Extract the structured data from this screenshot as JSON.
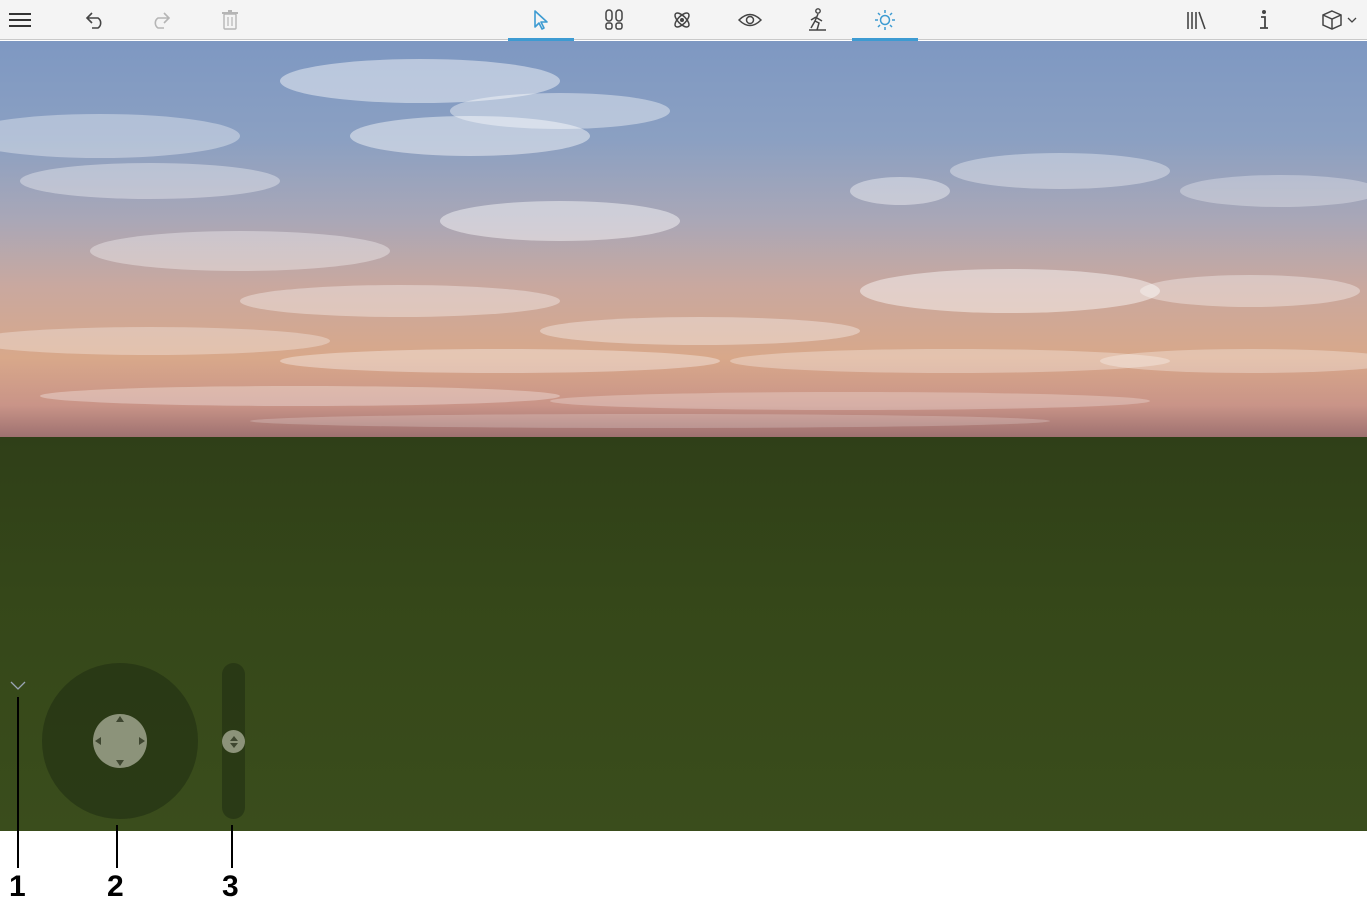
{
  "toolbar": {
    "left": [
      {
        "name": "menu-icon"
      },
      {
        "name": "undo-icon"
      },
      {
        "name": "redo-icon"
      },
      {
        "name": "delete-icon"
      }
    ],
    "modes": [
      {
        "name": "select-mode-icon",
        "active": true
      },
      {
        "name": "walk-footprints-icon",
        "active": false
      },
      {
        "name": "orbit-icon",
        "active": false
      },
      {
        "name": "view-eye-icon",
        "active": false
      },
      {
        "name": "person-walk-icon",
        "active": false
      },
      {
        "name": "sun-light-icon",
        "active": true
      }
    ],
    "right": [
      {
        "name": "library-icon"
      },
      {
        "name": "info-icon"
      },
      {
        "name": "view-cube-dropdown-icon"
      }
    ]
  },
  "colors": {
    "accent": "#3d9bd2",
    "toolbar_bg": "#f4f4f4",
    "ground": "#354719",
    "control_bg": "#26341499"
  },
  "callouts": {
    "c1": "1",
    "c2": "2",
    "c3": "3"
  }
}
